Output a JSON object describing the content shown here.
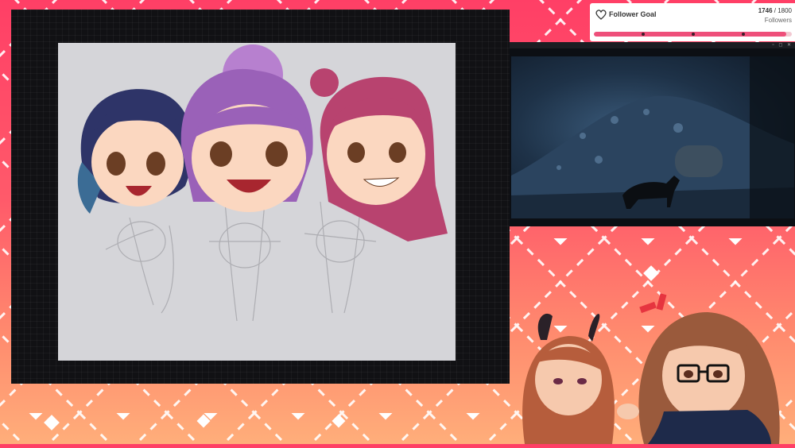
{
  "colors": {
    "accent": "#ee4f7a",
    "canvas_bg": "#d5d5d9",
    "frame_bg": "#111114"
  },
  "follower_goal": {
    "icon": "heart-outline-icon",
    "label": "Follower Goal",
    "current": "1746",
    "separator": " / ",
    "target": "1800",
    "unit": "Followers",
    "progress": 0.97
  },
  "video": {
    "controls": "▫ ◻ ✕"
  }
}
